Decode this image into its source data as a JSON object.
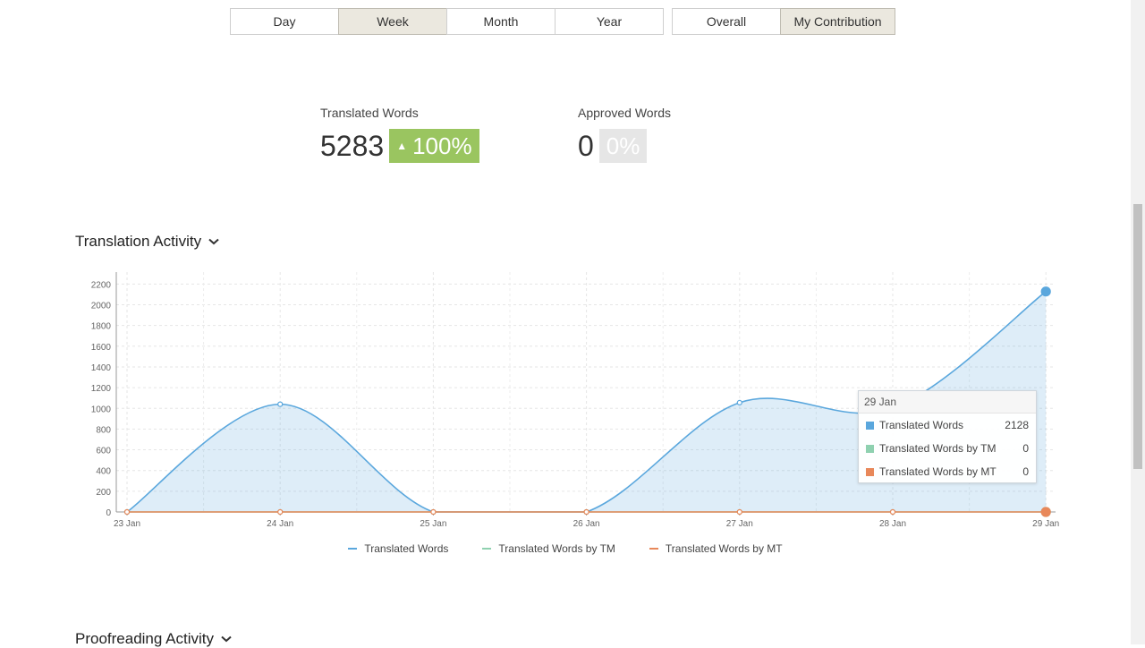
{
  "period_tabs": [
    "Day",
    "Week",
    "Month",
    "Year"
  ],
  "period_active": "Week",
  "scope_tabs": [
    "Overall",
    "My Contribution"
  ],
  "scope_active": "My Contribution",
  "stats": {
    "translated": {
      "label": "Translated Words",
      "value": "5283",
      "change": "100%"
    },
    "approved": {
      "label": "Approved Words",
      "value": "0",
      "change": "0%"
    }
  },
  "sections": {
    "translation_title": "Translation Activity",
    "proofreading_title": "Proofreading Activity"
  },
  "colors": {
    "translated": "#5aa7dd",
    "tm": "#8fd1b0",
    "mt": "#e8885a",
    "badge_green": "#9ac560"
  },
  "tooltip": {
    "date": "29 Jan",
    "rows": [
      {
        "name": "Translated Words",
        "value": "2128"
      },
      {
        "name": "Translated Words by TM",
        "value": "0"
      },
      {
        "name": "Translated Words by MT",
        "value": "0"
      }
    ]
  },
  "chart_data": {
    "type": "area",
    "categories": [
      "23 Jan",
      "24 Jan",
      "25 Jan",
      "26 Jan",
      "27 Jan",
      "28 Jan",
      "29 Jan"
    ],
    "y_ticks": [
      0,
      200,
      400,
      600,
      800,
      1000,
      1200,
      1400,
      1600,
      1800,
      2000,
      2200
    ],
    "ylim": [
      0,
      2350
    ],
    "series": [
      {
        "name": "Translated Words",
        "values": [
          0,
          1040,
          0,
          0,
          1055,
          1000,
          2128
        ]
      },
      {
        "name": "Translated Words by TM",
        "values": [
          0,
          0,
          0,
          0,
          0,
          0,
          0
        ]
      },
      {
        "name": "Translated Words by MT",
        "values": [
          0,
          0,
          0,
          0,
          0,
          0,
          0
        ]
      }
    ],
    "grid": true,
    "legend": "bottom"
  }
}
